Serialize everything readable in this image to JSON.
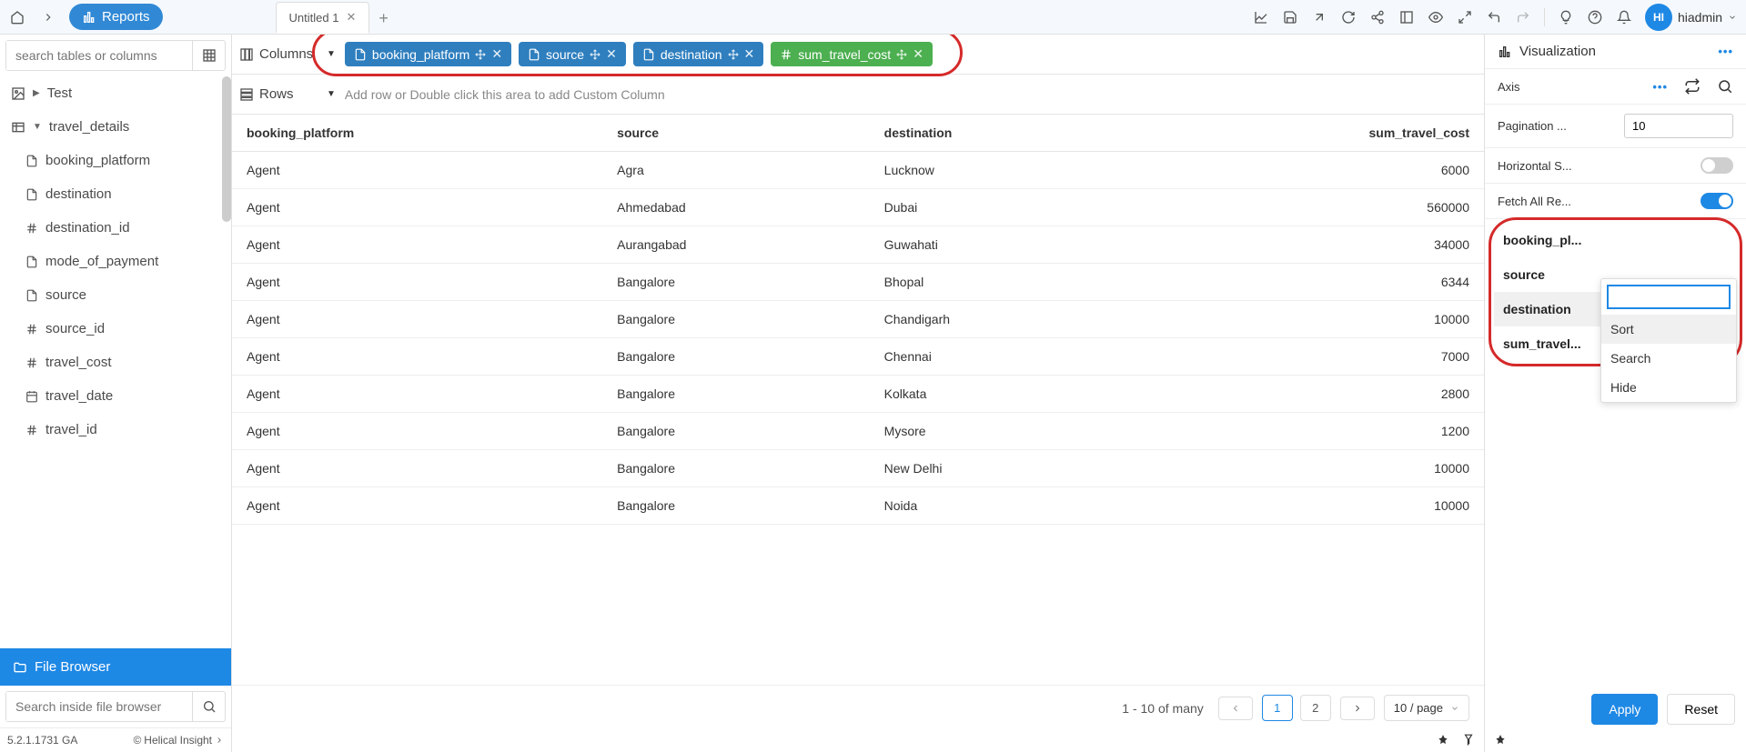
{
  "topbar": {
    "breadcrumb_label": "Reports",
    "tab_title": "Untitled 1",
    "username": "hiadmin",
    "avatar_initials": "HI"
  },
  "sidebar": {
    "search_placeholder": "search tables or columns",
    "file_search_placeholder": "Search inside file browser",
    "file_browser_label": "File Browser",
    "version": "5.2.1.1731 GA",
    "copyright": "Helical Insight",
    "tree": {
      "root": "Test",
      "table": "travel_details",
      "fields": [
        {
          "icon": "text",
          "label": "booking_platform"
        },
        {
          "icon": "text",
          "label": "destination"
        },
        {
          "icon": "hash",
          "label": "destination_id"
        },
        {
          "icon": "text",
          "label": "mode_of_payment"
        },
        {
          "icon": "text",
          "label": "source"
        },
        {
          "icon": "hash",
          "label": "source_id"
        },
        {
          "icon": "hash",
          "label": "travel_cost"
        },
        {
          "icon": "date",
          "label": "travel_date"
        },
        {
          "icon": "hash",
          "label": "travel_id"
        }
      ]
    }
  },
  "shelves": {
    "columns_label": "Columns",
    "rows_label": "Rows",
    "rows_placeholder": "Add row or Double click this area to add Custom Column",
    "column_pills": [
      {
        "label": "booking_platform",
        "color": "blue",
        "icon": "text"
      },
      {
        "label": "source",
        "color": "blue",
        "icon": "text"
      },
      {
        "label": "destination",
        "color": "blue",
        "icon": "text"
      },
      {
        "label": "sum_travel_cost",
        "color": "green",
        "icon": "hash"
      }
    ]
  },
  "table": {
    "headers": [
      "booking_platform",
      "source",
      "destination",
      "sum_travel_cost"
    ],
    "rows": [
      [
        "Agent",
        "Agra",
        "Lucknow",
        "6000"
      ],
      [
        "Agent",
        "Ahmedabad",
        "Dubai",
        "560000"
      ],
      [
        "Agent",
        "Aurangabad",
        "Guwahati",
        "34000"
      ],
      [
        "Agent",
        "Bangalore",
        "Bhopal",
        "6344"
      ],
      [
        "Agent",
        "Bangalore",
        "Chandigarh",
        "10000"
      ],
      [
        "Agent",
        "Bangalore",
        "Chennai",
        "7000"
      ],
      [
        "Agent",
        "Bangalore",
        "Kolkata",
        "2800"
      ],
      [
        "Agent",
        "Bangalore",
        "Mysore",
        "1200"
      ],
      [
        "Agent",
        "Bangalore",
        "New Delhi",
        "10000"
      ],
      [
        "Agent",
        "Bangalore",
        "Noida",
        "10000"
      ]
    ]
  },
  "pager": {
    "info": "1 - 10 of many",
    "pages": [
      "1",
      "2"
    ],
    "active": "1",
    "per_page": "10 / page"
  },
  "right": {
    "visualization_label": "Visualization",
    "axis_label": "Axis",
    "pagination_label": "Pagination ...",
    "pagination_value": "10",
    "horizontal_label": "Horizontal S...",
    "fetchall_label": "Fetch All Re...",
    "fields": [
      {
        "label": "booking_pl...",
        "sel": false
      },
      {
        "label": "source",
        "sel": false
      },
      {
        "label": "destination",
        "sel": true
      },
      {
        "label": "sum_travel...",
        "sel": false
      }
    ],
    "menu": [
      "Sort",
      "Search",
      "Hide"
    ],
    "apply": "Apply",
    "reset": "Reset"
  }
}
